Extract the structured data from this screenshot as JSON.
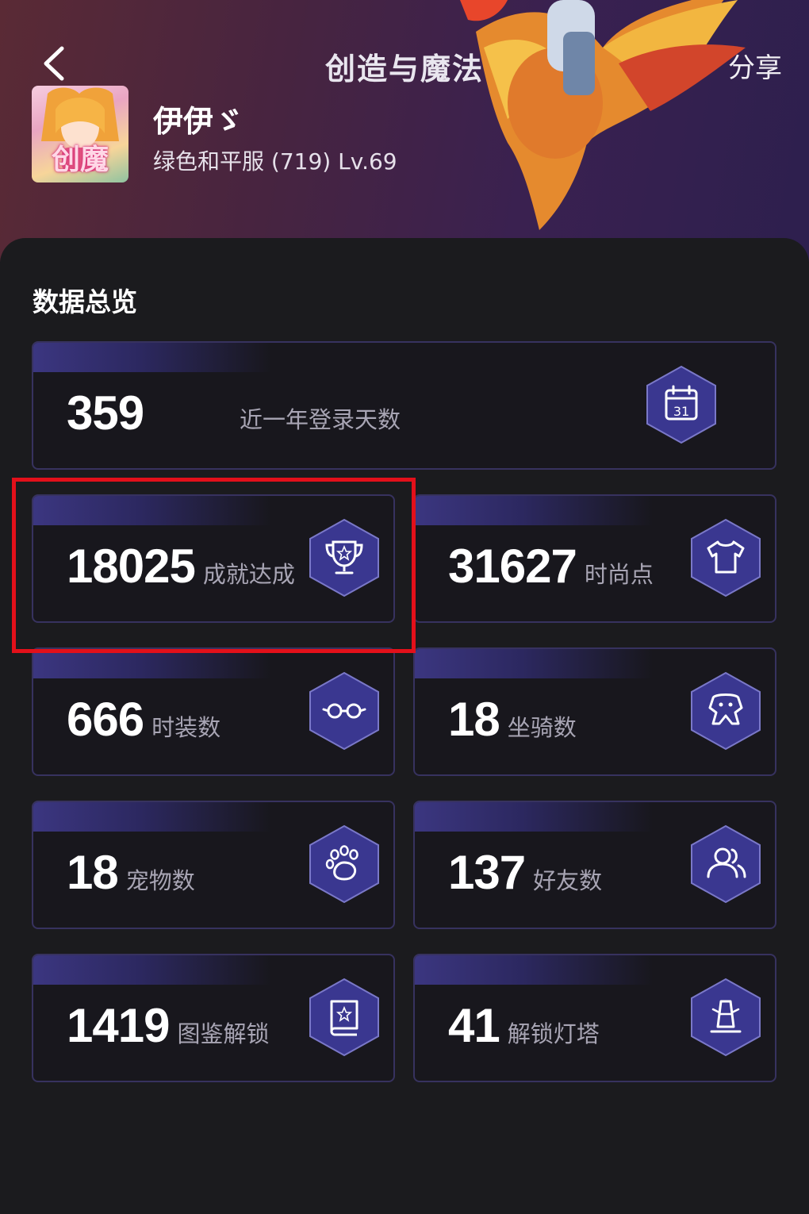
{
  "header": {
    "title": "创造与魔法",
    "share_label": "分享",
    "avatar_text": "创魔",
    "username": "伊伊ゞ",
    "server_info": "绿色和平服 (719) Lv.69"
  },
  "overview": {
    "section_title": "数据总览",
    "stats": [
      {
        "value": "359",
        "label": "近一年登录天数",
        "icon": "calendar-icon",
        "icon_text": "31"
      },
      {
        "value": "18025",
        "label": "成就达成",
        "icon": "trophy-icon"
      },
      {
        "value": "31627",
        "label": "时尚点",
        "icon": "tshirt-icon"
      },
      {
        "value": "666",
        "label": "时装数",
        "icon": "glasses-icon"
      },
      {
        "value": "18",
        "label": "坐骑数",
        "icon": "mount-icon"
      },
      {
        "value": "18",
        "label": "宠物数",
        "icon": "paw-icon"
      },
      {
        "value": "137",
        "label": "好友数",
        "icon": "friends-icon"
      },
      {
        "value": "1419",
        "label": "图鉴解锁",
        "icon": "book-icon"
      },
      {
        "value": "41",
        "label": "解锁灯塔",
        "icon": "lighthouse-icon"
      }
    ]
  },
  "colors": {
    "accent": "#3b3680",
    "card_border": "#37325f",
    "highlight": "#e3101a"
  }
}
